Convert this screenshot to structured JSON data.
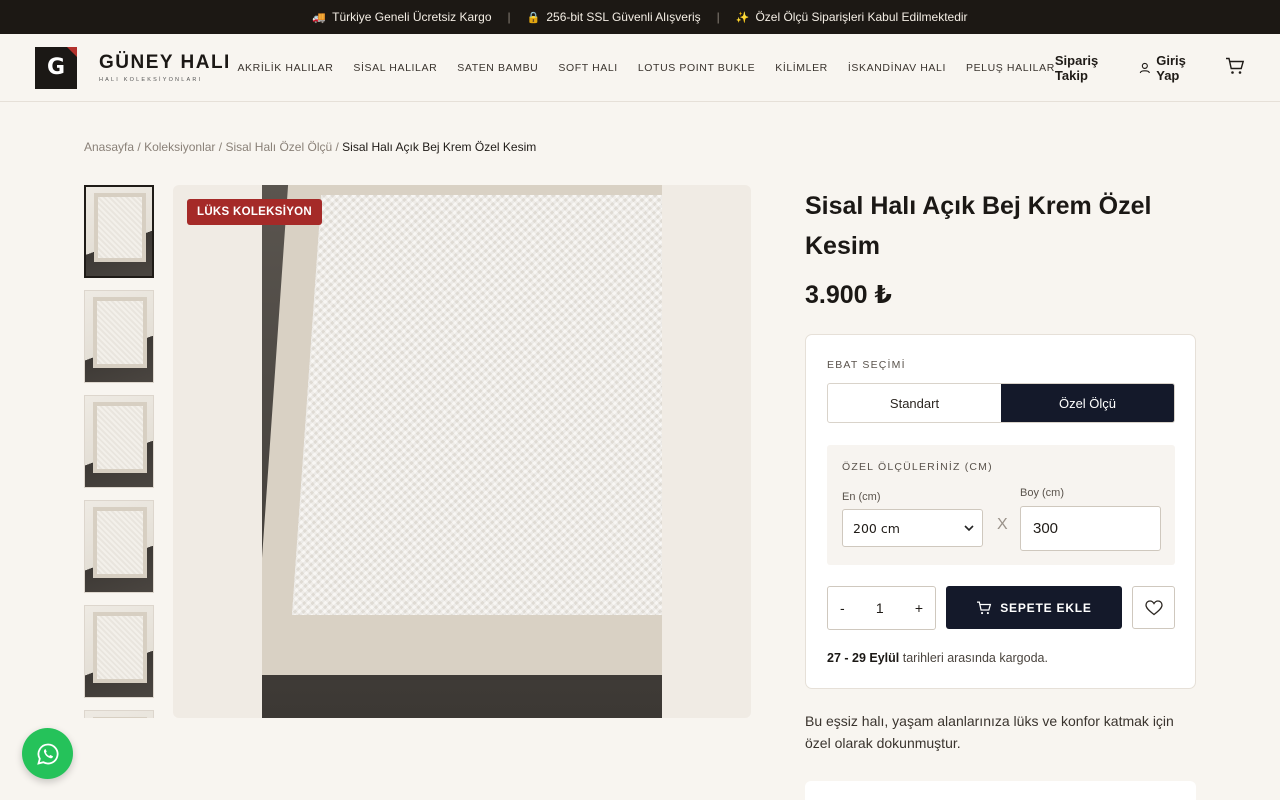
{
  "topbar": {
    "items": [
      {
        "icon": "truck-icon",
        "text": "Türkiye Geneli Ücretsiz Kargo"
      },
      {
        "icon": "lock-icon",
        "text": "256-bit SSL Güvenli Alışveriş"
      },
      {
        "icon": "sparkle-icon",
        "text": "Özel Ölçü Siparişleri Kabul Edilmektedir"
      }
    ],
    "separator": "|"
  },
  "brand": {
    "mark": "G",
    "name": "GÜNEY HALI",
    "tagline": "HALI KOLEKSİYONLARI"
  },
  "nav": [
    "AKRİLİK HALILAR",
    "SİSAL HALILAR",
    "SATEN BAMBU",
    "SOFT HALI",
    "LOTUS POINT BUKLE",
    "KİLİMLER",
    "İSKANDİNAV HALI",
    "PELUŞ HALILAR"
  ],
  "header_right": {
    "track": "Sipariş Takip",
    "login": "Giriş Yap"
  },
  "breadcrumb": {
    "items": [
      "Anasayfa",
      "Koleksiyonlar",
      "Sisal Halı Özel Ölçü"
    ],
    "separator": " / ",
    "current": "Sisal Halı Açık Bej Krem Özel Kesim"
  },
  "product": {
    "badge": "LÜKS KOLEKSİYON",
    "title": "Sisal Halı Açık Bej Krem Özel Kesim",
    "price": "3.900 ₺",
    "description": "Bu eşsiz halı, yaşam alanlarınıza lüks ve konfor katmak için özel olarak dokunmuştur."
  },
  "size": {
    "label": "EBAT SEÇİMİ",
    "options": [
      "Standart",
      "Özel Ölçü"
    ],
    "selected": "Özel Ölçü",
    "custom_label": "ÖZEL ÖLÇÜLERİNİZ (CM)",
    "width_label": "En (cm)",
    "width_value": "200 cm",
    "times": "X",
    "length_label": "Boy (cm)",
    "length_value": "300"
  },
  "cart": {
    "minus": "-",
    "qty": "1",
    "plus": "+",
    "add_label": "SEPETE EKLE"
  },
  "shipping": {
    "dates": "27 - 29 Eylül",
    "text": " tarihleri arasında kargoda."
  },
  "colors": {
    "accent": "#14192a",
    "badge": "#a52a28",
    "whatsapp": "#25c25a",
    "topbar": "#1c1814"
  }
}
